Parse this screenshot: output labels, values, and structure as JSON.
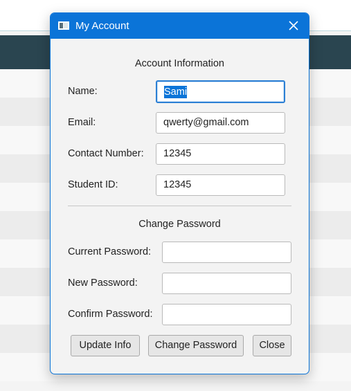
{
  "dialog": {
    "title": "My Account",
    "close_glyph": "×"
  },
  "account_section": {
    "heading": "Account Information",
    "fields": [
      {
        "label": "Name:",
        "value": "Sami"
      },
      {
        "label": "Email:",
        "value": "qwerty@gmail.com"
      },
      {
        "label": "Contact Number:",
        "value": "12345"
      },
      {
        "label": "Student ID:",
        "value": "12345"
      }
    ]
  },
  "password_section": {
    "heading": "Change Password",
    "fields": [
      {
        "label": "Current Password:",
        "value": ""
      },
      {
        "label": "New Password:",
        "value": ""
      },
      {
        "label": "Confirm Password:",
        "value": ""
      }
    ]
  },
  "buttons": {
    "update": "Update Info",
    "change": "Change Password",
    "close": "Close"
  },
  "colors": {
    "accent": "#0b74d8",
    "selection": "#0a74d8",
    "background_band": "#2a4550"
  },
  "icons": {
    "app": "window-icon",
    "close": "close-icon"
  }
}
